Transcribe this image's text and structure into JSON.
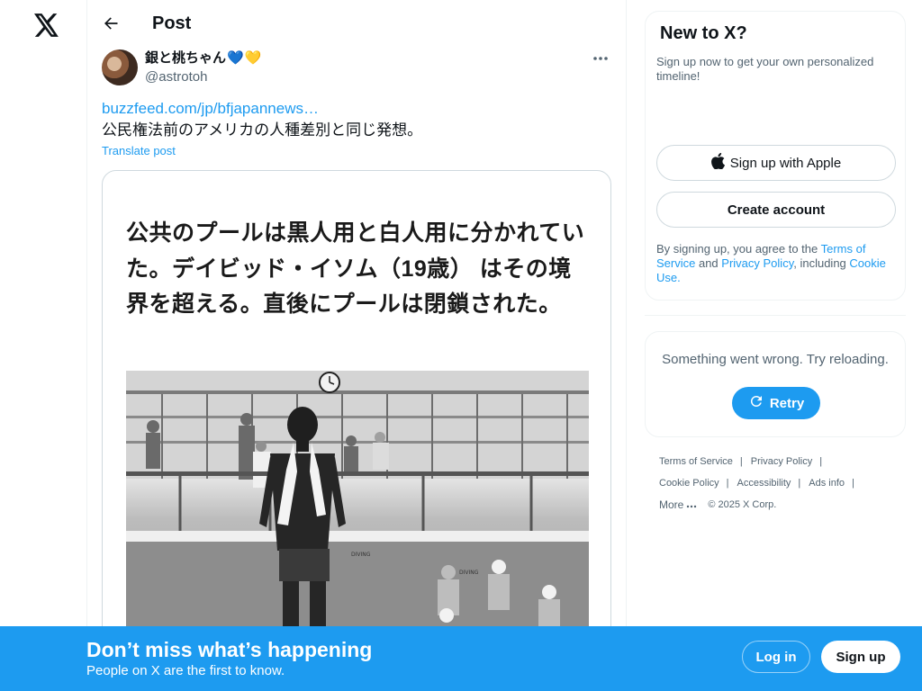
{
  "nav": {
    "logo_icon": "x-logo-icon"
  },
  "header": {
    "back_icon": "arrow-left-icon",
    "title": "Post"
  },
  "post": {
    "author_name": "銀と桃ちゃん",
    "author_emoji": [
      "💙",
      "💛"
    ],
    "author_handle": "@astrotoh",
    "link": "buzzfeed.com/jp/bfjapannews…",
    "text": "公民権法前のアメリカの人種差別と同じ発想。",
    "translate": "Translate post",
    "media_caption": "公共のプールは黒人用と白人用に分かれていた。デイビッド・イソム（19歳） はその境界を超える。直後にプールは閉鎖された。"
  },
  "sidebar": {
    "signup": {
      "title": "New to X?",
      "subtitle": "Sign up now to get your own personalized timeline!",
      "apple_button": "Sign up with Apple",
      "create_button": "Create account",
      "legal_prefix": "By signing up, you agree to the ",
      "terms": "Terms of Service",
      "and": " and ",
      "privacy": "Privacy Policy",
      "including": ", including ",
      "cookie": "Cookie Use."
    },
    "error": {
      "message": "Something went wrong. Try reloading.",
      "retry": "Retry"
    },
    "footer": {
      "terms": "Terms of Service",
      "privacy": "Privacy Policy",
      "cookie": "Cookie Policy",
      "accessibility": "Accessibility",
      "ads": "Ads info",
      "more": "More",
      "copyright": "© 2025 X Corp.",
      "separator": "|"
    }
  },
  "bottom_bar": {
    "title": "Don’t miss what’s happening",
    "subtitle": "People on X are the first to know.",
    "login": "Log in",
    "signup": "Sign up"
  },
  "colors": {
    "accent": "#1d9bf0",
    "text": "#0f1419",
    "muted": "#536471"
  }
}
